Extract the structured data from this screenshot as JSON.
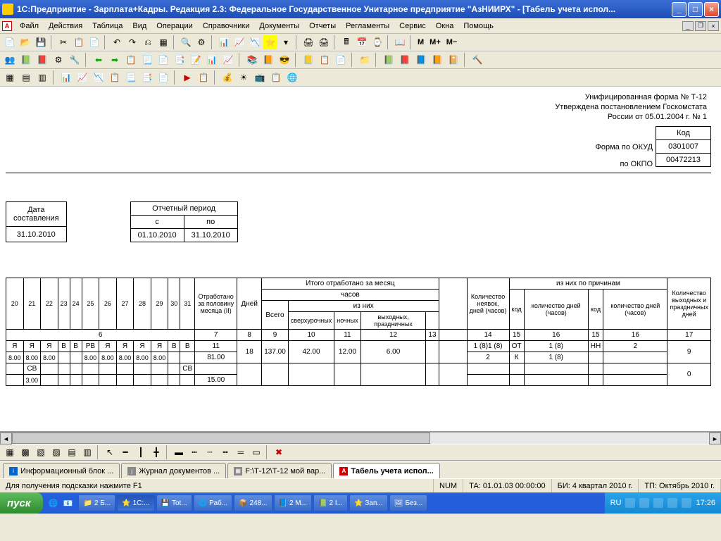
{
  "titlebar": {
    "title": "1С:Предприятие - Зарплата+Кадры. Редакция 2.3: Федеральное Государственное Унитарное предприятие \"АзНИИРХ\" - [Табель учета испол..."
  },
  "menu": [
    "Файл",
    "Действия",
    "Таблица",
    "Вид",
    "Операции",
    "Справочники",
    "Документы",
    "Отчеты",
    "Регламенты",
    "Сервис",
    "Окна",
    "Помощь"
  ],
  "txtbtns": {
    "m": "M",
    "mp": "M+",
    "mm": "M−"
  },
  "doc": {
    "header_lines": [
      "Унифицированная форма № Т-12",
      "Утверждена постановлением Госкомстата",
      "России от 05.01.2004 г. № 1"
    ],
    "code_label": "Код",
    "okud_label": "Форма по ОКУД",
    "okud": "0301007",
    "okpo_label": "по ОКПО",
    "okpo": "00472213",
    "date_compiled_label1": "Дата",
    "date_compiled_label2": "составления",
    "date_compiled": "31.10.2010",
    "period_label": "Отчетный период",
    "period_from_label": "с",
    "period_to_label": "по",
    "period_from": "01.10.2010",
    "period_to": "31.10.2010",
    "cols_days": [
      "20",
      "21",
      "22",
      "23",
      "24",
      "25",
      "26",
      "27",
      "28",
      "29",
      "30",
      "31"
    ],
    "hdr_worked_half": "Отработано за половину месяца (II)",
    "hdr_days": "Дней",
    "hdr_total_month": "Итого отработано за месяц",
    "hdr_hours": "часов",
    "hdr_vsego": "Всего",
    "hdr_of_them": "из них",
    "hdr_overtime": "сверхурочных",
    "hdr_night": "ночных",
    "hdr_holiday": "выходных, праздничных",
    "hdr_absences": "Количество неявок, дней (часов)",
    "hdr_by_reason": "из них по причинам",
    "hdr_code": "код",
    "hdr_qty": "количество дней (часов)",
    "hdr_weekend": "Количество выходных и праздничных дней",
    "colnum6": "6",
    "colnum7": "7",
    "colnum8": "8",
    "colnum9": "9",
    "colnum10": "10",
    "colnum11": "11",
    "colnum12": "12",
    "colnum13": "13",
    "colnum14": "14",
    "colnum15": "15",
    "colnum16": "16",
    "colnum17": "17",
    "row_marks": [
      "Я",
      "Я",
      "Я",
      "В",
      "В",
      "РВ",
      "Я",
      "Я",
      "Я",
      "Я",
      "В",
      "В"
    ],
    "row_hours": [
      "8.00",
      "8.00",
      "8.00",
      "",
      "",
      "8.00",
      "8.00",
      "8.00",
      "8.00",
      "8.00",
      "",
      ""
    ],
    "half_val": "11",
    "half_hours": "81.00",
    "days_val": "18",
    "vsego_val": "137.00",
    "over_val": "42.00",
    "night_val": "12.00",
    "hol_val": "6.00",
    "abs1": "1 (8)1 (8)",
    "abs2": "2",
    "code1": "ОТ",
    "code2": "К",
    "qty1": "1 (8)",
    "qty2": "1 (8)",
    "code3": "НН",
    "qty3": "2",
    "weekend_val": "9",
    "weekend_val2": "0",
    "extra_hours": "15.00",
    "sv": "СВ",
    "h3": "3.00"
  },
  "tabs": [
    {
      "icon": "i",
      "label": "Информационный блок ..."
    },
    {
      "icon": "j",
      "label": "Журнал документов ..."
    },
    {
      "icon": "f",
      "label": "F:\\Т-12\\Т-12 мой вар..."
    },
    {
      "icon": "a",
      "label": "Табель учета испол...",
      "active": true
    }
  ],
  "status": {
    "hint": "Для получения подсказки нажмите F1",
    "num": "NUM",
    "ta": "ТА: 01.01.03 00:00:00",
    "bi": "БИ: 4 квартал 2010 г.",
    "tp": "ТП: Октябрь 2010 г."
  },
  "taskbar": {
    "start": "пуск",
    "tasks": [
      "2 Б...",
      "1С:...",
      "Tot...",
      "Раб...",
      "248...",
      "2 M...",
      "2 I...",
      "Зап...",
      "Без..."
    ],
    "lang": "RU",
    "time": "17:26"
  }
}
